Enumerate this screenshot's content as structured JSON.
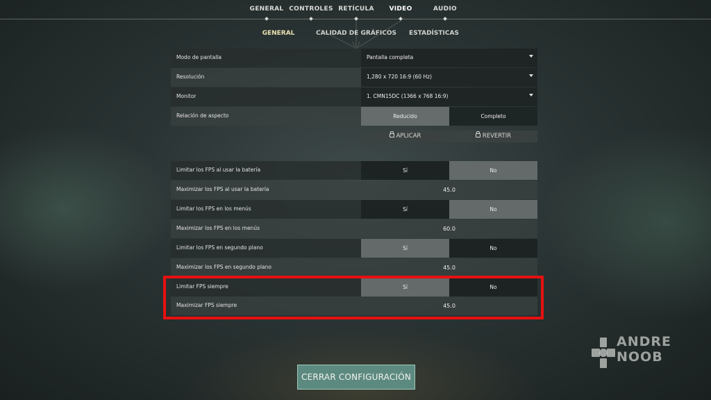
{
  "nav": {
    "tabs": [
      {
        "label": "GENERAL"
      },
      {
        "label": "CONTROLES"
      },
      {
        "label": "RETÍCULA"
      },
      {
        "label": "VIDEO"
      },
      {
        "label": "AUDIO"
      }
    ],
    "active_tab": "VIDEO"
  },
  "subnav": {
    "tabs": [
      {
        "label": "GENERAL"
      },
      {
        "label": "CALIDAD DE GRÁFICOS"
      },
      {
        "label": "ESTADÍSTICAS"
      }
    ],
    "active_tab": "GENERAL"
  },
  "settings": {
    "display_mode": {
      "label": "Modo de pantalla",
      "value": "Pantalla completa"
    },
    "resolution": {
      "label": "Resolución",
      "value": "1,280 x 720 16:9 (60 Hz)"
    },
    "monitor": {
      "label": "Monitor",
      "value": "1. CMN15DC (1366 x  768 16:9)"
    },
    "aspect": {
      "label": "Relación de aspecto",
      "option_a": "Reducido",
      "option_b": "Completo",
      "selected": "Reducido"
    },
    "apply_label": "APLICAR",
    "revert_label": "REVERTIR",
    "limit_battery": {
      "label": "Limitar los FPS al usar la batería",
      "option_a": "Sí",
      "option_b": "No",
      "selected": "No"
    },
    "max_battery": {
      "label": "Maximizar los FPS al usar la batería",
      "value": "45.0"
    },
    "limit_menus": {
      "label": "Limitar los FPS en los menús",
      "option_a": "Sí",
      "option_b": "No",
      "selected": "No"
    },
    "max_menus": {
      "label": "Maximizar los FPS en los menús",
      "value": "60.0"
    },
    "limit_background": {
      "label": "Limitar los FPS en segundo plano",
      "option_a": "Sí",
      "option_b": "No",
      "selected": "Sí"
    },
    "max_background": {
      "label": "Maximizar los FPS en segundo plano",
      "value": "45.0"
    },
    "limit_always": {
      "label": "Limitar FPS siempre",
      "option_a": "Sí",
      "option_b": "No",
      "selected": "Sí"
    },
    "max_always": {
      "label": "Maximizar FPS siempre",
      "value": "45.0"
    }
  },
  "close_button": "CERRAR CONFIGURACIÓN",
  "watermark": {
    "line1": "ANDRE",
    "line2": "NOOB"
  },
  "colors": {
    "highlight": "#e81010",
    "close_button": "#5d8a80"
  }
}
